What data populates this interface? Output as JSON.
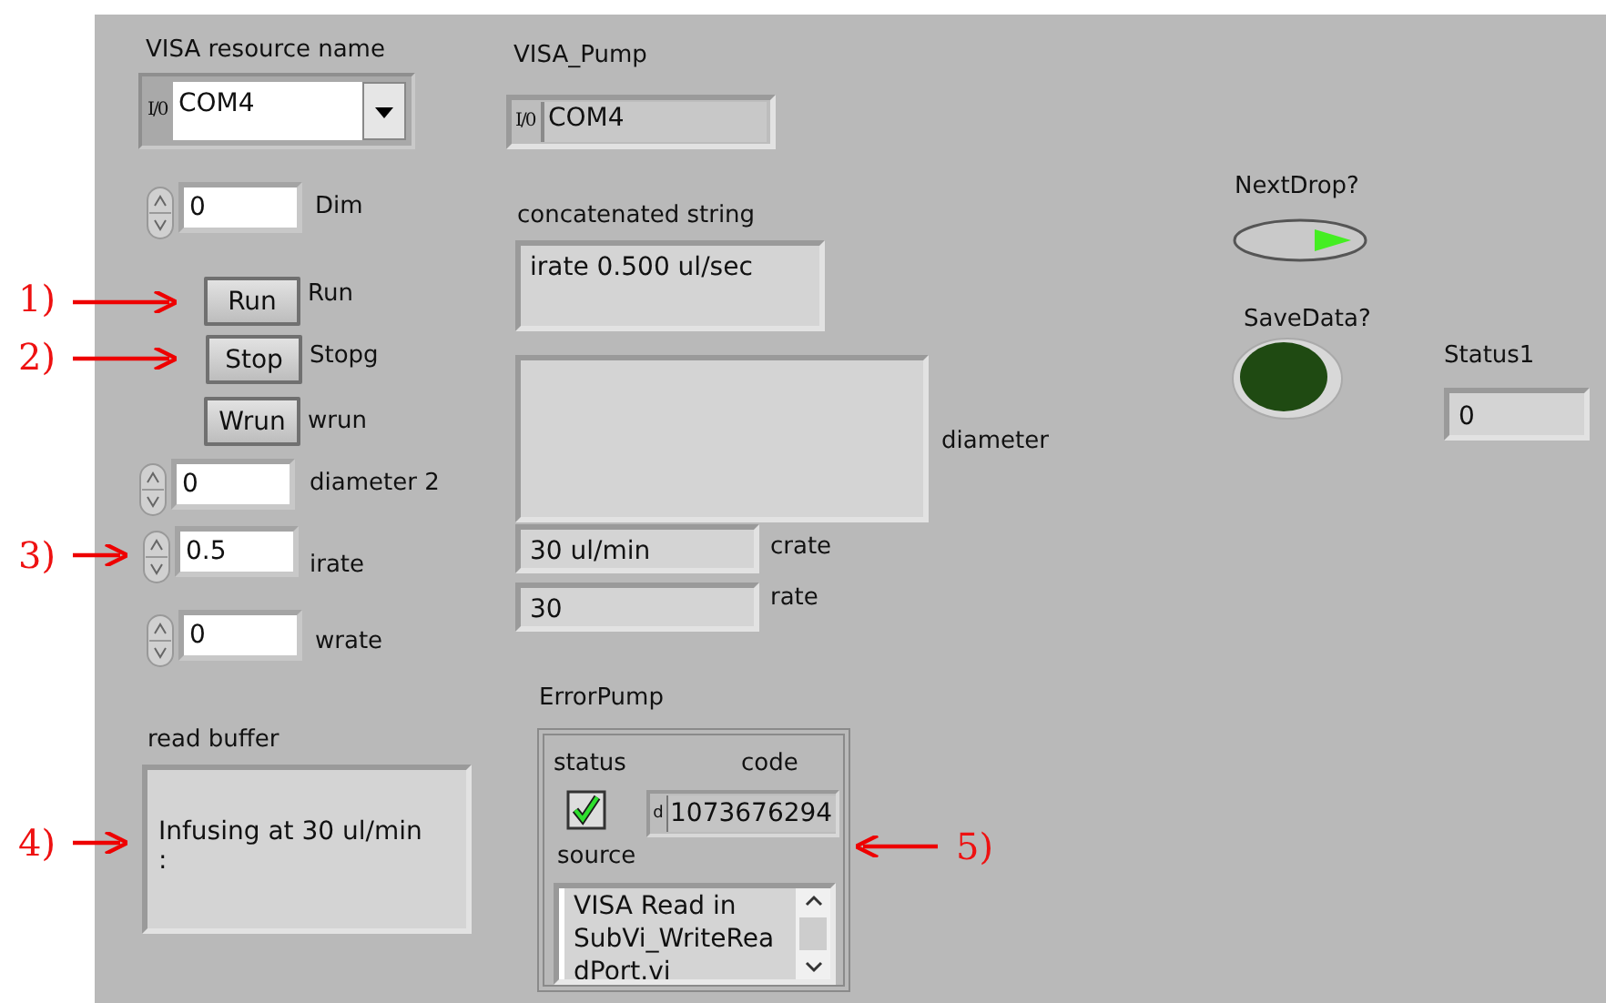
{
  "visa_resource": {
    "label": "VISA resource name",
    "prefix": "I/0",
    "value": "COM4"
  },
  "visa_pump": {
    "label": "VISA_Pump",
    "prefix": "I/0",
    "value": "COM4"
  },
  "numerics": [
    {
      "value": "0",
      "label": "Dim"
    },
    {
      "value": "0",
      "label": "diameter 2"
    },
    {
      "value": "0.5",
      "label": "irate"
    },
    {
      "value": "0",
      "label": "wrate"
    }
  ],
  "buttons": [
    {
      "text": "Run",
      "label": "Run"
    },
    {
      "text": "Stop",
      "label": "Stopg"
    },
    {
      "text": "Wrun",
      "label": "wrun"
    }
  ],
  "concatenated": {
    "label": "concatenated string",
    "value": "irate 0.500 ul/sec"
  },
  "diameter": {
    "label": "diameter"
  },
  "indicators": [
    {
      "value": "30 ul/min",
      "label": "crate"
    },
    {
      "value": "30",
      "label": "rate"
    }
  ],
  "read_buffer": {
    "label": "read buffer",
    "lines": [
      "Infusing at 30 ul/min",
      ":"
    ]
  },
  "error_cluster": {
    "label": "ErrorPump",
    "status_label": "status",
    "status": true,
    "code_label": "code",
    "code_prefix": "d",
    "code": "1073676294",
    "source_label": "source",
    "source_lines": [
      "VISA Read in",
      "SubVi_WriteRea",
      "dPort.vi"
    ]
  },
  "next_drop": {
    "label": "NextDrop?",
    "on": true
  },
  "save_data": {
    "label": "SaveData?",
    "on": false
  },
  "status1": {
    "label": "Status1",
    "value": "0"
  },
  "callouts": [
    {
      "label": "1)"
    },
    {
      "label": "2)"
    },
    {
      "label": "3)"
    },
    {
      "label": "4)"
    },
    {
      "label": "5)"
    }
  ]
}
